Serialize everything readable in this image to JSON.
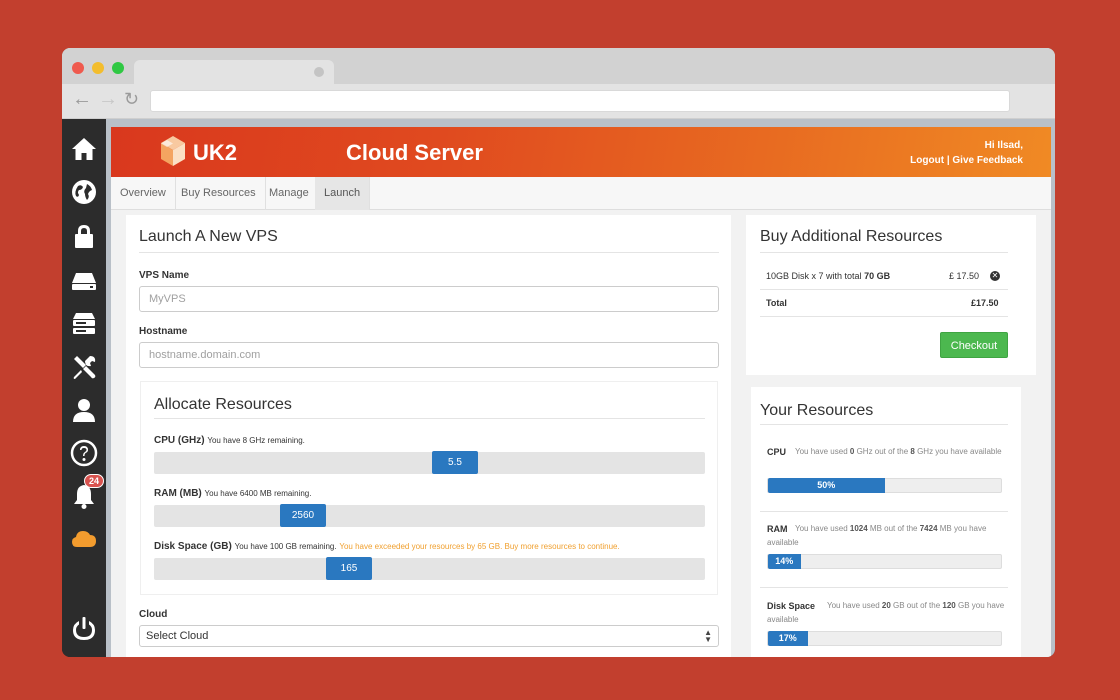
{
  "app": {
    "brand": "UK2",
    "title": "Cloud Server",
    "greeting": "Hi Ilsad,",
    "logout": "Logout",
    "separator": "|",
    "feedback": "Give Feedback"
  },
  "tabs": [
    "Overview",
    "Buy Resources",
    "Manage",
    "Launch"
  ],
  "sidebar": {
    "icons": [
      "home-icon",
      "globe-icon",
      "lock-icon",
      "drive-icon",
      "server-icon",
      "tools-icon",
      "user-icon",
      "help-icon",
      "bell-icon",
      "cloud-icon",
      "power-icon"
    ],
    "notification_count": "24"
  },
  "launch": {
    "title": "Launch A New VPS",
    "vps_name_label": "VPS Name",
    "vps_name_placeholder": "MyVPS",
    "hostname_label": "Hostname",
    "hostname_placeholder": "hostname.domain.com",
    "allocate_title": "Allocate Resources",
    "cpu_label": "CPU (GHz)",
    "cpu_note": "You have 8 GHz remaining.",
    "cpu_value": "5.5",
    "cpu_fraction": 0.55,
    "ram_label": "RAM (MB)",
    "ram_note": "You have 6400 MB remaining.",
    "ram_value": "2560",
    "ram_fraction": 0.25,
    "disk_label": "Disk Space (GB)",
    "disk_note": "You have 100 GB remaining.",
    "disk_warning": "You have exceeded your resources by 65 GB. Buy more resources to continue.",
    "disk_value": "165",
    "disk_fraction": 0.34,
    "cloud_label": "Cloud",
    "cloud_select": "Select Cloud"
  },
  "buy": {
    "title": "Buy Additional Resources",
    "item_prefix": "10GB Disk x 7 with total",
    "item_total": "70 GB",
    "item_price": "£ 17.50",
    "total_label": "Total",
    "total_value": "£17.50",
    "checkout": "Checkout"
  },
  "your_resources": {
    "title": "Your Resources",
    "cpu": {
      "name": "CPU",
      "used_pre": "You have used",
      "used": "0",
      "mid": "GHz out of the",
      "total": "8",
      "post": "GHz you have available",
      "percent_label": "50%",
      "fraction": 0.5
    },
    "ram": {
      "name": "RAM",
      "used_pre": "You have used",
      "used": "1024",
      "mid": "MB out of the",
      "total": "7424",
      "post": "MB you have available",
      "percent_label": "14%",
      "fraction": 0.14
    },
    "disk": {
      "name": "Disk Space",
      "used_pre": "You have used",
      "used": "20",
      "mid": "GB out of the",
      "total": "120",
      "post": "GB you have available",
      "percent_label": "17%",
      "fraction": 0.17
    }
  },
  "colors": {
    "page_background": "#c23f2e",
    "header_start": "#d9381e",
    "header_end": "#f08a24",
    "accent_blue": "#2a78c0",
    "checkout_green": "#4cb84f",
    "warning_orange": "#f0a030"
  }
}
